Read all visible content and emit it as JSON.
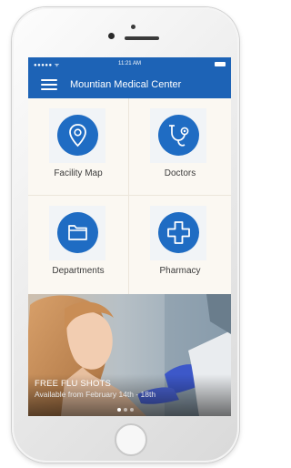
{
  "status_bar": {
    "signal": "●●●●● ᯤ",
    "time": "11:21 AM"
  },
  "header": {
    "title": "Mountian Medical Center",
    "menu_icon": "hamburger-icon"
  },
  "tiles": [
    {
      "label": "Facility Map",
      "icon": "map-pin-icon"
    },
    {
      "label": "Doctors",
      "icon": "stethoscope-icon"
    },
    {
      "label": "Departments",
      "icon": "folder-icon"
    },
    {
      "label": "Pharmacy",
      "icon": "medical-cross-icon"
    }
  ],
  "banner": {
    "title": "FREE FLU SHOTS",
    "subtitle": "Available from February 14th - 18th",
    "slides": 3,
    "active_slide": 1
  },
  "colors": {
    "brand_blue": "#1d63b6",
    "icon_blue": "#1f6cc3",
    "tile_bg": "#fbf8f2"
  }
}
